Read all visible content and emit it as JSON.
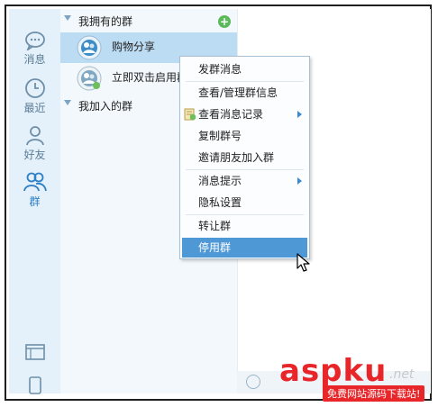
{
  "nav": {
    "items": [
      {
        "label": "消息",
        "icon": "chat-bubble-icon"
      },
      {
        "label": "最近",
        "icon": "clock-icon"
      },
      {
        "label": "好友",
        "icon": "person-icon"
      },
      {
        "label": "群",
        "icon": "group-icon"
      }
    ],
    "active": "群"
  },
  "groups": {
    "owned_header": "我拥有的群",
    "joined_header": "我加入的群",
    "owned": [
      {
        "name": "购物分享",
        "selected": true
      },
      {
        "name": "立即双击启用群"
      }
    ]
  },
  "context_menu": {
    "items": [
      {
        "label": "发群消息"
      },
      {
        "label": "查看/管理群信息"
      },
      {
        "label": "查看消息记录",
        "submenu": true
      },
      {
        "label": "复制群号"
      },
      {
        "label": "邀请朋友加入群"
      },
      {
        "label": "消息提示",
        "submenu": true
      },
      {
        "label": "隐私设置"
      },
      {
        "label": "转让群"
      },
      {
        "label": "停用群",
        "highlighted": true
      }
    ]
  },
  "watermark": {
    "main": "aspku",
    "suffix": ".net",
    "sub": "免费网站源码下载站!"
  },
  "colors": {
    "accent": "#4f98d6",
    "selection": "#bcdcf3",
    "rail_bg": "#e4f1fa",
    "watermark_red": "#e8262a"
  }
}
